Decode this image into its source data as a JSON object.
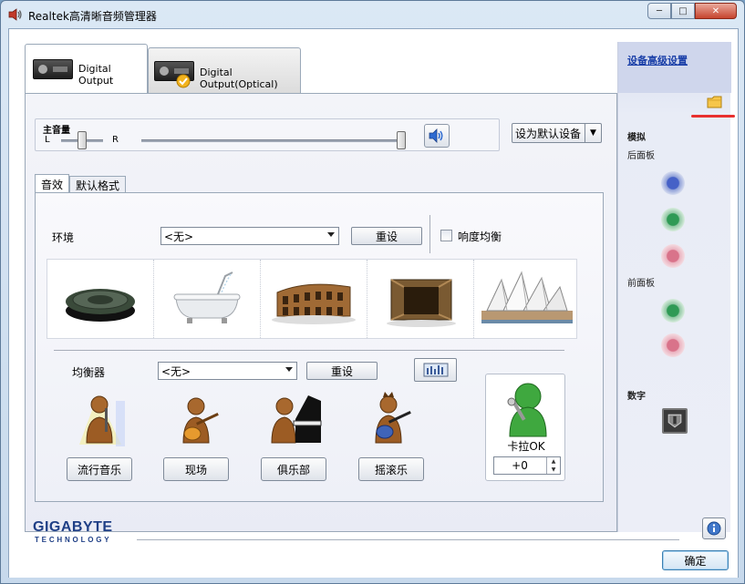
{
  "window": {
    "title": "Realtek高清晰音频管理器",
    "controls": {
      "minimize": "─",
      "maximize": "□",
      "close": "✕"
    }
  },
  "device_tabs": [
    {
      "label": "Digital Output",
      "active": true
    },
    {
      "label": "Digital Output(Optical)",
      "active": false
    }
  ],
  "volume": {
    "title": "主音量",
    "left_label": "L",
    "right_label": "R",
    "balance_position": 0.5,
    "master_level": 1.0
  },
  "default_device_button": "设为默认设备",
  "inner_tabs": [
    {
      "label": "音效",
      "active": true
    },
    {
      "label": "默认格式",
      "active": false
    }
  ],
  "environment": {
    "label": "环境",
    "selected": "<无>",
    "reset_label": "重设",
    "loudness_label": "响度均衡",
    "loudness_checked": false,
    "presets": [
      "stone-disc",
      "bathtub",
      "colosseum",
      "stone-corridor",
      "opera-house"
    ]
  },
  "equalizer": {
    "label": "均衡器",
    "selected": "<无>",
    "reset_label": "重设",
    "genres": [
      {
        "label": "流行音乐",
        "icon": "pop-singer-icon"
      },
      {
        "label": "现场",
        "icon": "live-guitar-icon"
      },
      {
        "label": "俱乐部",
        "icon": "club-piano-icon"
      },
      {
        "label": "摇滚乐",
        "icon": "rock-guitar-icon"
      }
    ]
  },
  "karaoke": {
    "label": "卡拉OK",
    "value": "+0"
  },
  "side_panel": {
    "advanced_link": "设备高级设置",
    "analog_label": "模拟",
    "back_panel_label": "后面板",
    "front_panel_label": "前面板",
    "digital_label": "数字",
    "back_jacks": [
      "blue",
      "green",
      "pink"
    ],
    "front_jacks": [
      "green",
      "pink"
    ]
  },
  "footer": {
    "brand": "GIGABYTE",
    "brand_sub": "TECHNOLOGY",
    "ok_label": "确定",
    "info_label": "i"
  },
  "colors": {
    "brand_blue": "#1f3f86",
    "link_blue": "#1a3fa8",
    "annotation_red": "#e8302e"
  }
}
